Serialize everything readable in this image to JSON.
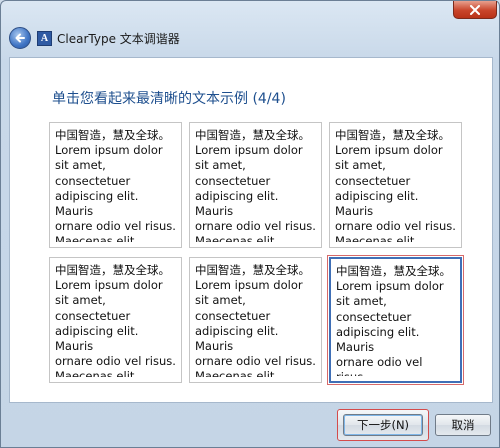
{
  "window": {
    "title": "ClearType 文本调谐器",
    "app_icon_glyph": "A"
  },
  "main": {
    "heading": "单击您看起来最清晰的文本示例 (4/4)",
    "samples": [
      {
        "text": "中国智造，慧及全球。\nLorem ipsum dolor\nsit amet,\nconsectetuer\nadipiscing elit. Mauris\nornare odio vel risus.\nMaecenas elit metus,",
        "selected": false
      },
      {
        "text": "中国智造，慧及全球。\nLorem ipsum dolor\nsit amet,\nconsectetuer\nadipiscing elit. Mauris\nornare odio vel risus.\nMaecenas elit metus,",
        "selected": false
      },
      {
        "text": "中国智造，慧及全球。\nLorem ipsum dolor\nsit amet,\nconsectetuer\nadipiscing elit. Mauris\nornare odio vel risus.\nMaecenas elit metus,",
        "selected": false
      },
      {
        "text": "中国智造，慧及全球。\nLorem ipsum dolor\nsit amet,\nconsectetuer\nadipiscing elit. Mauris\nornare odio vel risus.\nMaecenas elit metus,",
        "selected": false
      },
      {
        "text": "中国智造，慧及全球。\nLorem ipsum dolor\nsit amet,\nconsectetuer\nadipiscing elit. Mauris\nornare odio vel risus.\nMaecenas elit metus,",
        "selected": false
      },
      {
        "text": "中国智造，慧及全球。\nLorem ipsum dolor\nsit amet,\nconsectetuer\nadipiscing elit. Mauris\nornare odio vel risus.\nMaecenas elit metus,",
        "selected": true
      }
    ]
  },
  "footer": {
    "next_label": "下一步(N)",
    "cancel_label": "取消"
  },
  "colors": {
    "heading": "#1e4f8e",
    "selection_border": "#3f6fb6",
    "close_button": "#c9452b"
  },
  "icons": {
    "close": "close-icon",
    "back": "back-arrow-icon",
    "app": "cleartype-app-icon"
  }
}
